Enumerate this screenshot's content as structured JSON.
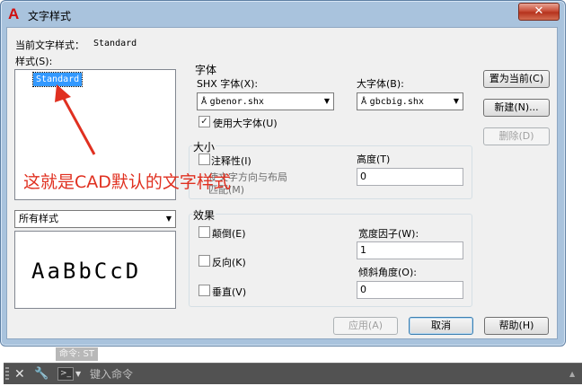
{
  "window": {
    "title": "文字样式",
    "app_icon_glyph": "A",
    "close_glyph": "✕"
  },
  "current_style": {
    "label": "当前文字样式：",
    "value": "Standard"
  },
  "styles": {
    "label": "样式(S):",
    "items": [
      "Standard"
    ],
    "filter_value": "所有样式",
    "preview_text": "AaBbCcD"
  },
  "font": {
    "group_title": "字体",
    "shx_label": "SHX 字体(X):",
    "shx_value": "gbenor.shx",
    "bigfont_label": "大字体(B):",
    "bigfont_value": "gbcbig.shx",
    "use_bigfont_label": "使用大字体(U)",
    "use_bigfont_checked": true
  },
  "size": {
    "group_title": "大小",
    "annotative_label": "注释性(I)",
    "annotative_checked": false,
    "match_orientation_label": "使文字方向与布局",
    "match_orientation_label2": "匹配(M)",
    "height_label": "高度(T)",
    "height_value": "0"
  },
  "effects": {
    "group_title": "效果",
    "upside_down_label": "颠倒(E)",
    "backwards_label": "反向(K)",
    "vertical_label": "垂直(V)",
    "width_factor_label": "宽度因子(W):",
    "width_factor_value": "1",
    "oblique_label": "倾斜角度(O):",
    "oblique_value": "0"
  },
  "buttons": {
    "set_current": "置为当前(C)",
    "new": "新建(N)...",
    "delete": "删除(D)",
    "apply": "应用(A)",
    "cancel": "取消",
    "help": "帮助(H)"
  },
  "annotation": {
    "text": "这就是CAD默认的文字样式",
    "color": "#e03020"
  },
  "command_line": {
    "history": "命令: ST",
    "placeholder": "键入命令"
  }
}
